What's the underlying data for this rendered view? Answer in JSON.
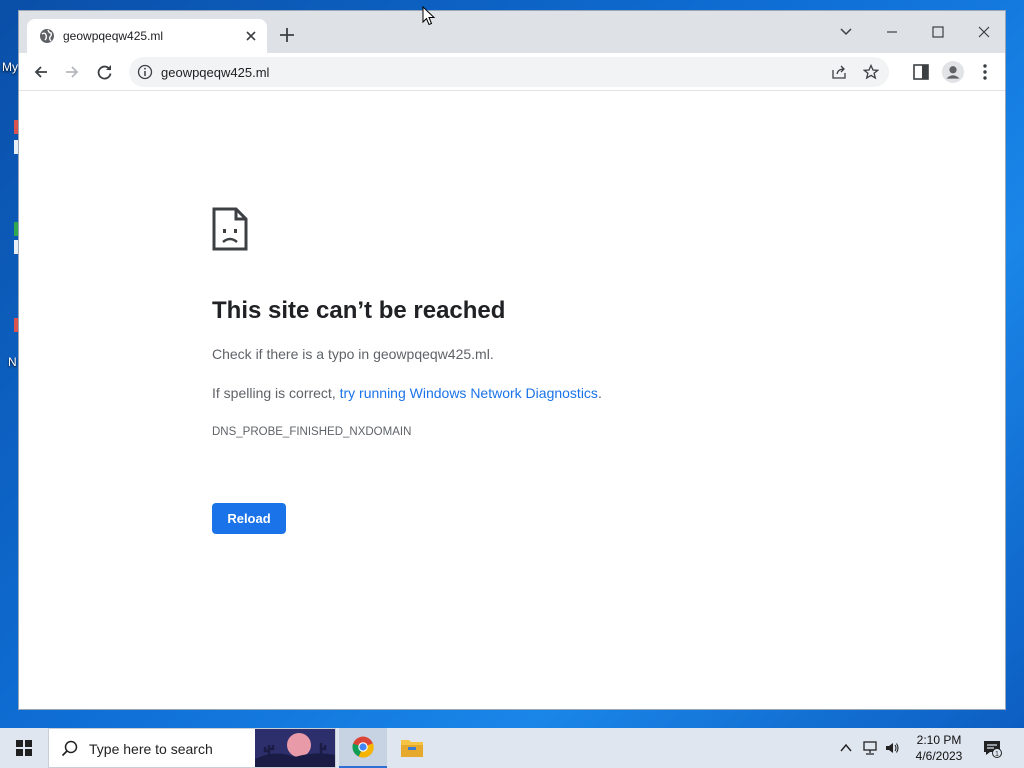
{
  "desktop": {
    "labels": [
      "My",
      "N"
    ]
  },
  "browser": {
    "tab": {
      "title": "geowpqeqw425.ml"
    },
    "address_bar": {
      "url": "geowpqeqw425.ml"
    }
  },
  "error_page": {
    "title": "This site can’t be reached",
    "line1": "Check if there is a typo in geowpqeqw425.ml.",
    "line2_prefix": "If spelling is correct, ",
    "line2_link": "try running Windows Network Diagnostics",
    "line2_suffix": ".",
    "error_code": "DNS_PROBE_FINISHED_NXDOMAIN",
    "reload_label": "Reload"
  },
  "taskbar": {
    "search_placeholder": "Type here to search",
    "time": "2:10 PM",
    "date": "4/6/2023",
    "notification_count": "1"
  },
  "colors": {
    "accent": "#1a73e8",
    "tabstrip": "#dee1e6",
    "taskbar": "#dfe6f0"
  }
}
